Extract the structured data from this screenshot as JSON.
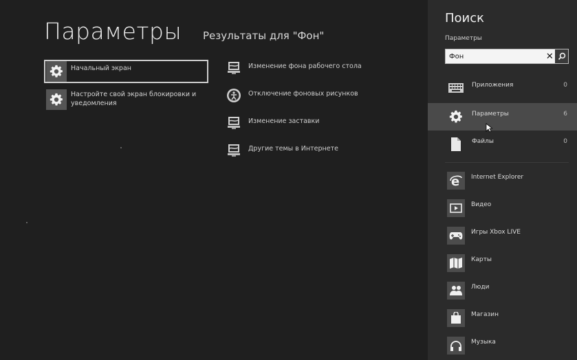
{
  "main": {
    "title": "Параметры",
    "results_heading": "Результаты для \"Фон\"",
    "settings": [
      {
        "label": "Начальный экран",
        "selected": true,
        "icon": "gear-icon"
      },
      {
        "label": "Настройте свой экран блокировки и уведомления",
        "selected": false,
        "icon": "gear-icon"
      }
    ],
    "control_panel_results": [
      {
        "label": "Изменение фона рабочего стола",
        "icon": "display-settings-icon"
      },
      {
        "label": "Отключение фоновых рисунков",
        "icon": "ease-of-access-icon"
      },
      {
        "label": "Изменение заставки",
        "icon": "display-settings-icon"
      },
      {
        "label": "Другие темы в Интернете",
        "icon": "display-settings-icon"
      }
    ]
  },
  "search_pane": {
    "title": "Поиск",
    "scope_label": "Параметры",
    "query": "Фон",
    "clear_symbol": "✕",
    "scopes": [
      {
        "label": "Приложения",
        "count": "0",
        "icon": "keyboard-icon",
        "active": false
      },
      {
        "label": "Параметры",
        "count": "6",
        "icon": "gear-icon",
        "active": true
      },
      {
        "label": "Файлы",
        "count": "0",
        "icon": "file-icon",
        "active": false
      }
    ],
    "apps": [
      {
        "label": "Internet Explorer",
        "icon": "internet-explorer-icon"
      },
      {
        "label": "Видео",
        "icon": "video-icon"
      },
      {
        "label": "Игры Xbox LIVE",
        "icon": "gamepad-icon"
      },
      {
        "label": "Карты",
        "icon": "map-icon"
      },
      {
        "label": "Люди",
        "icon": "people-icon"
      },
      {
        "label": "Магазин",
        "icon": "store-bag-icon"
      },
      {
        "label": "Музыка",
        "icon": "headphones-icon"
      }
    ]
  },
  "colors": {
    "background": "#1f1f1f",
    "pane": "#2b2b2b",
    "active_row": "#4a4a4a",
    "text": "#e0e0e0"
  }
}
